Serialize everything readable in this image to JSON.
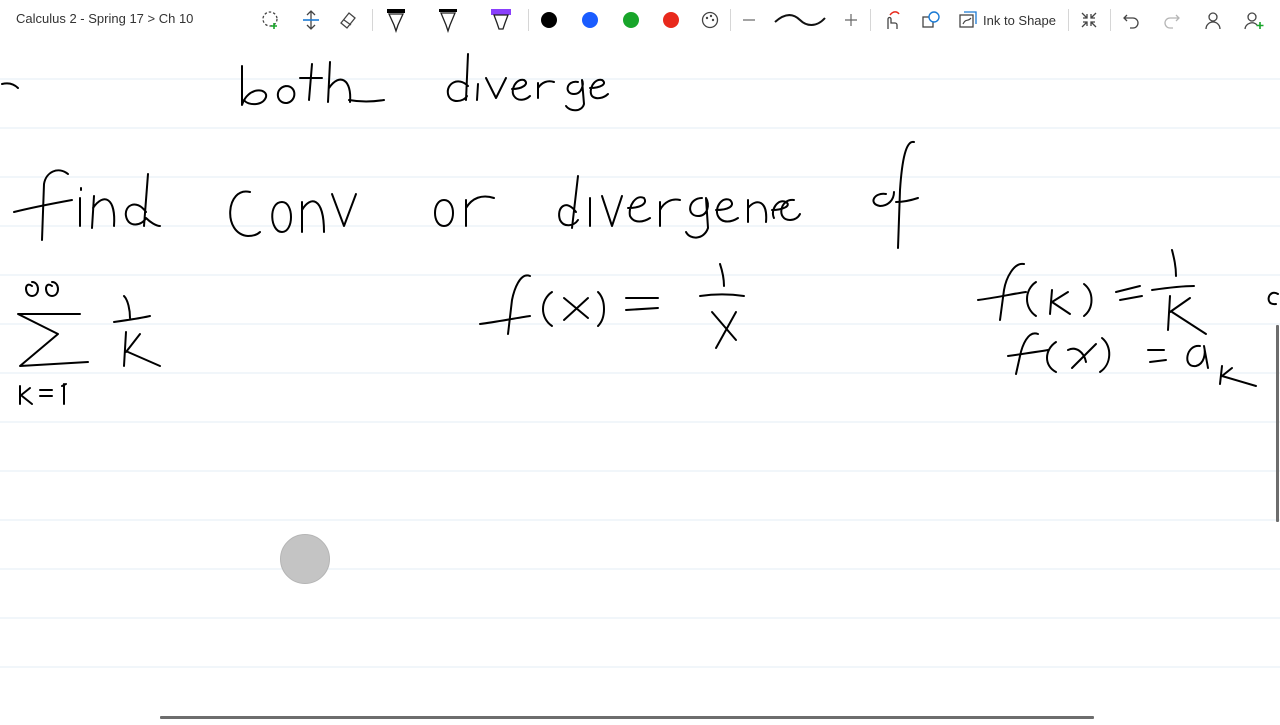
{
  "breadcrumb": "Calculus 2 - Spring 17 > Ch 10",
  "toolbar": {
    "ink_to_shape_label": "Ink to Shape",
    "colors": [
      "#000000",
      "#1a5cff",
      "#18a52a",
      "#e8291c"
    ],
    "highlighter_color": "#8a3ffc"
  },
  "notes": {
    "line1": "both diverge",
    "line2": "find conv or divergence of",
    "sum_upper": "∞",
    "sum_lower": "k=1",
    "sum_term": "1/k",
    "eq_fx": "f(x) = 1/x",
    "eq_fk": "f(k) = 1/k",
    "eq_fak": "f(k) = a_k"
  }
}
